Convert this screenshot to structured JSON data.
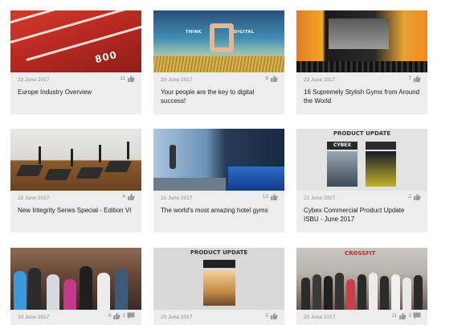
{
  "cards": [
    {
      "date": "23 June 2017",
      "likes": "11",
      "comments": "",
      "title": "Europe Industry Overview",
      "thumb_text": "800"
    },
    {
      "date": "23 June 2017",
      "likes": "8",
      "comments": "",
      "title": "Your people are the key to digital success!",
      "thumb_text_left": "THINK",
      "thumb_text_right": "DIGITAL"
    },
    {
      "date": "23 June 2017",
      "likes": "7",
      "comments": "",
      "title": "16 Supremely Stylish Gyms from Around the World"
    },
    {
      "date": "22 June 2017",
      "likes": "4",
      "comments": "",
      "title": "New Integrity Series Special - Edition VI"
    },
    {
      "date": "21 June 2017",
      "likes": "13",
      "comments": "",
      "title": "The world's most amazing hotel gyms"
    },
    {
      "date": "21 June 2017",
      "likes": "2",
      "comments": "",
      "title": "Cybex Commercial Product Update ISBU - June 2017",
      "thumb_banner": "PRODUCT UPDATE",
      "thumb_logo": "CYBEX"
    },
    {
      "date": "20 June 2017",
      "likes": "9",
      "comments": "1",
      "title": ""
    },
    {
      "date": "20 June 2017",
      "likes": "5",
      "comments": "",
      "title": "",
      "thumb_banner": "PRODUCT UPDATE"
    },
    {
      "date": "20 June 2017",
      "likes": "11",
      "comments": "3",
      "title": "",
      "thumb_sign": "CROSSFIT"
    }
  ],
  "icons": {
    "like": "thumbs-up-icon",
    "comment": "comment-icon"
  },
  "colors": {
    "card_bg": "#ededee",
    "meta_text": "#8a8a8a",
    "title_text": "#1a1a1a"
  }
}
